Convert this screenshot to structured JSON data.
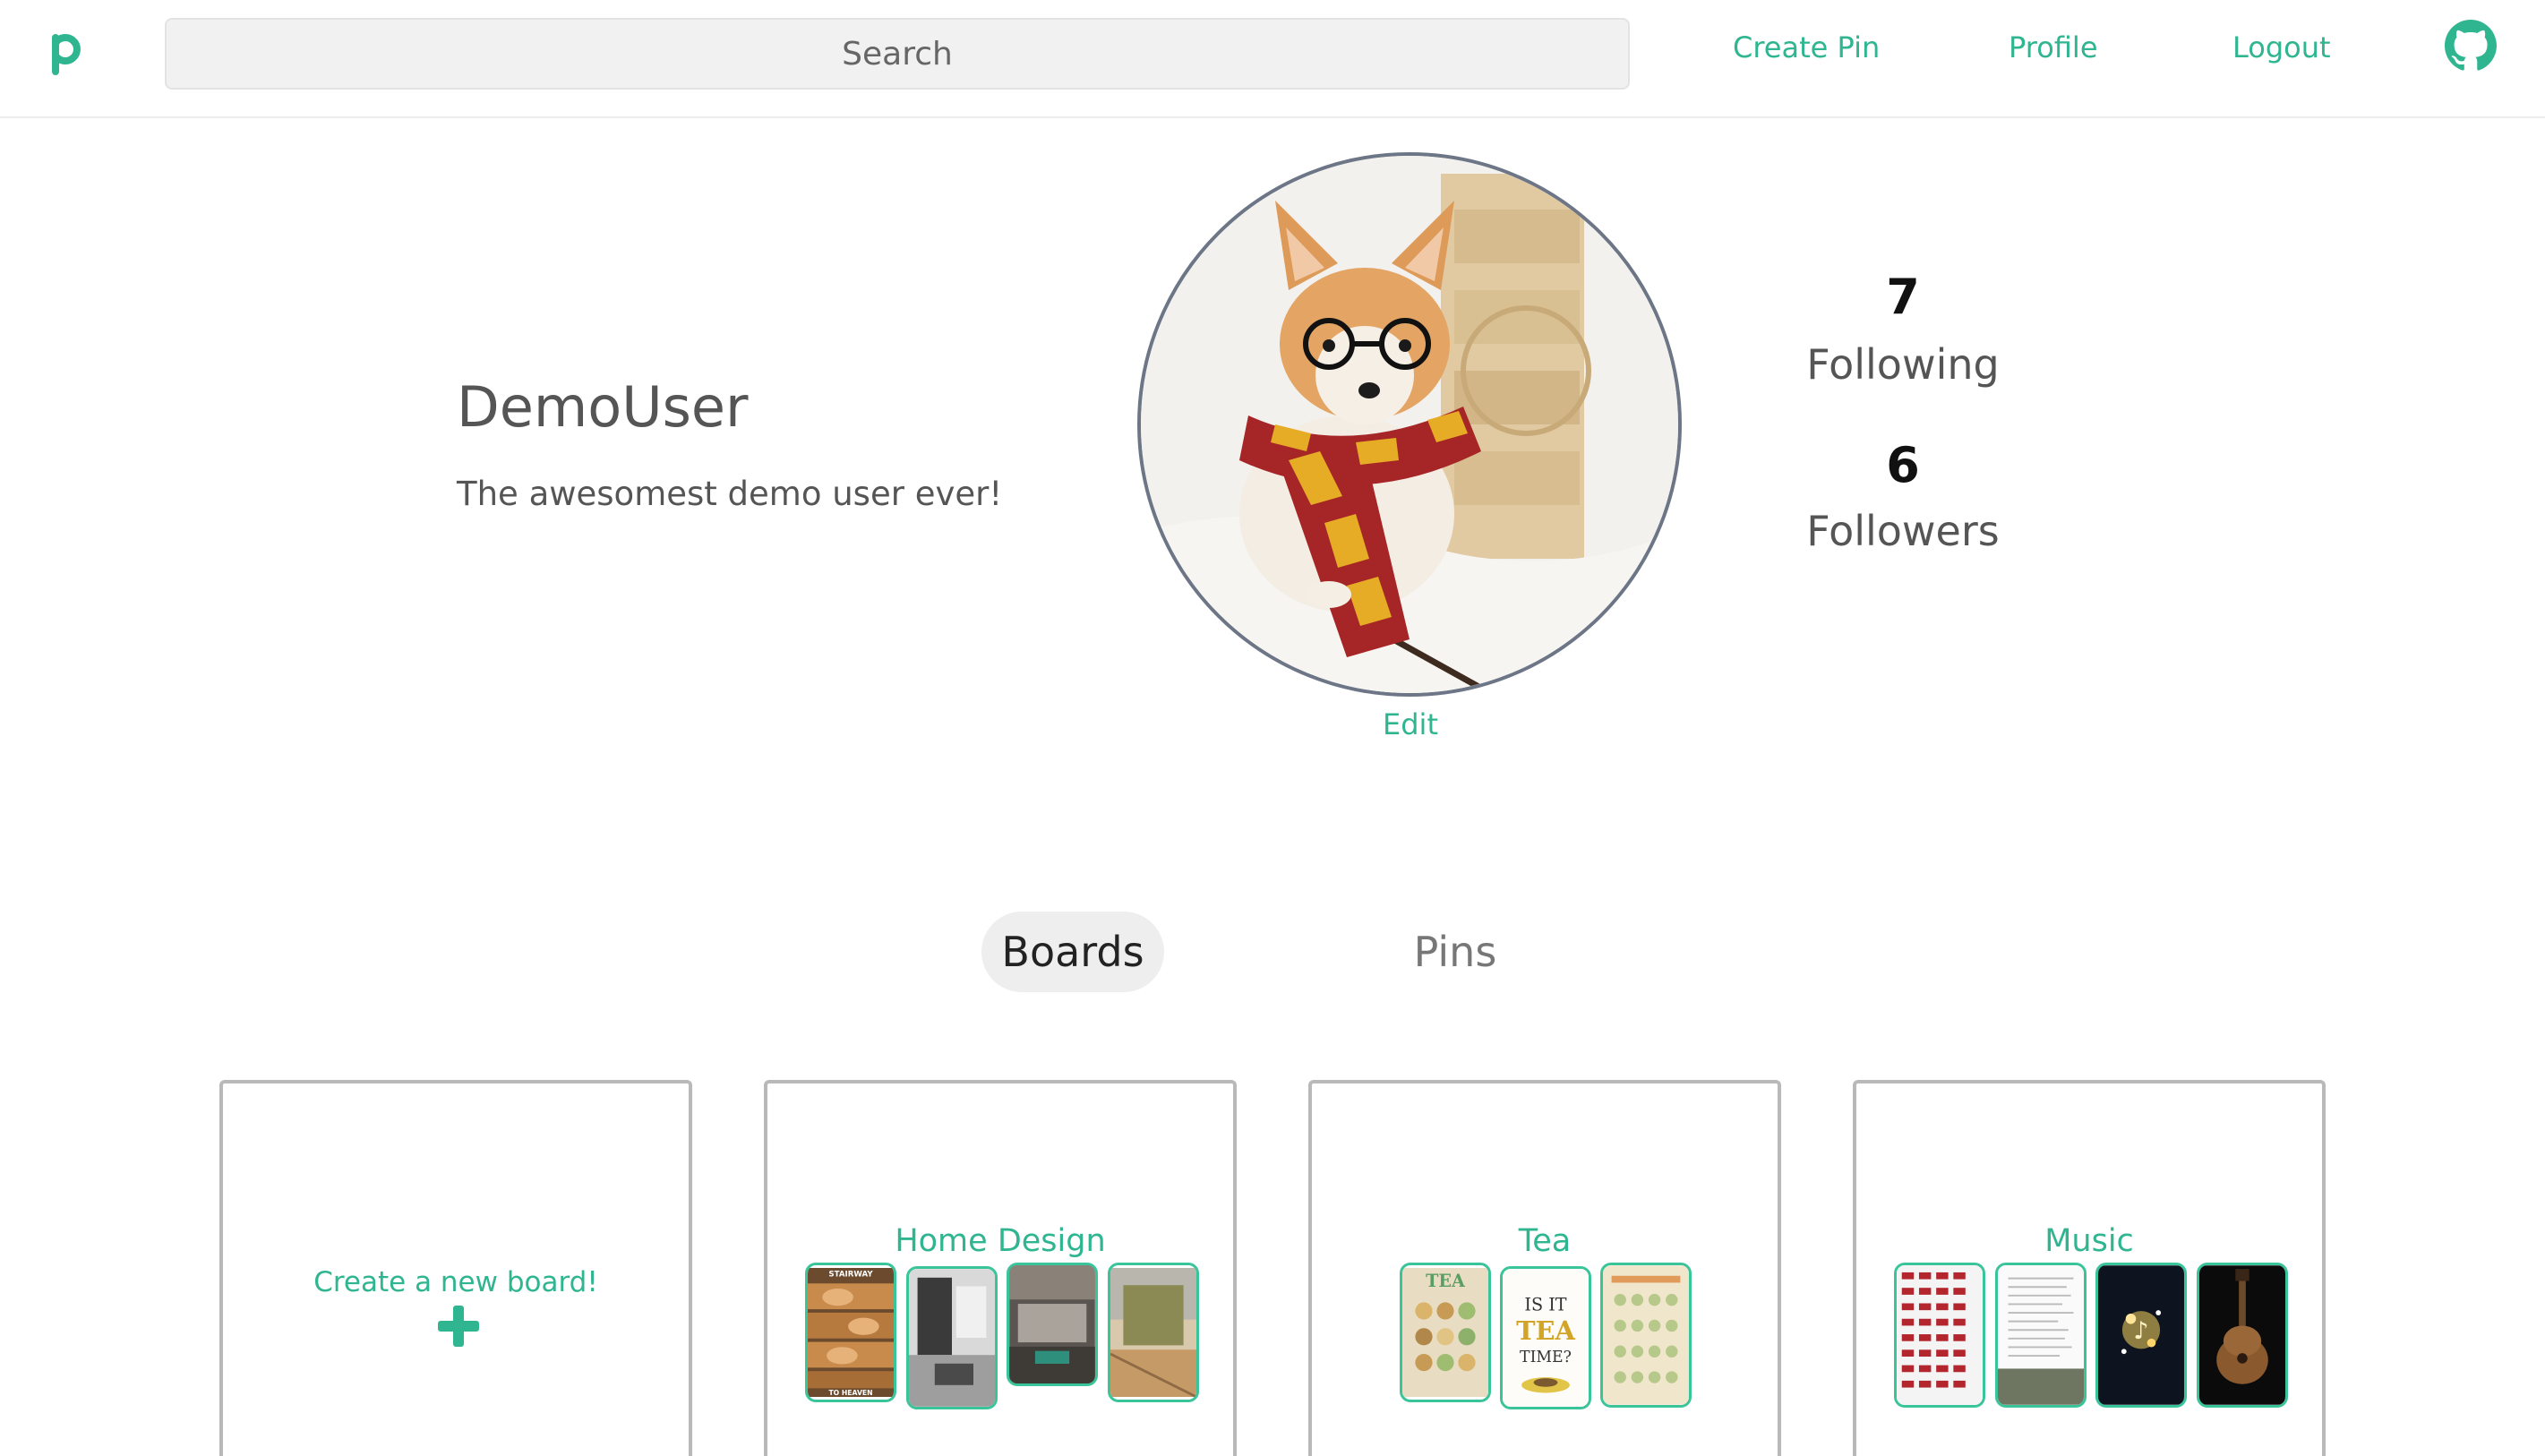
{
  "nav": {
    "logo_letter": "p",
    "search_placeholder": "Search",
    "links": [
      "Create Pin",
      "Profile",
      "Logout"
    ],
    "github_icon": "github-icon",
    "accent_color": "#2fb590"
  },
  "profile": {
    "username": "DemoUser",
    "bio": "The awesomest demo user ever!",
    "avatar_icon": "corgi-avatar",
    "edit_label": "Edit",
    "following_count": "7",
    "following_label": "Following",
    "followers_count": "6",
    "followers_label": "Followers"
  },
  "tabs": {
    "boards": "Boards",
    "pins": "Pins",
    "active": "Boards"
  },
  "boards": {
    "create_label": "Create a new board!",
    "create_icon": "plus-icon",
    "items": [
      {
        "title": "Home Design"
      },
      {
        "title": "Tea",
        "thumb_texts": [
          "TEA",
          "IS IT",
          "TEA",
          "TIME?"
        ]
      },
      {
        "title": "Music"
      }
    ],
    "home_thumb_texts": [
      "STAIRWAY",
      "TO HEAVEN"
    ]
  }
}
